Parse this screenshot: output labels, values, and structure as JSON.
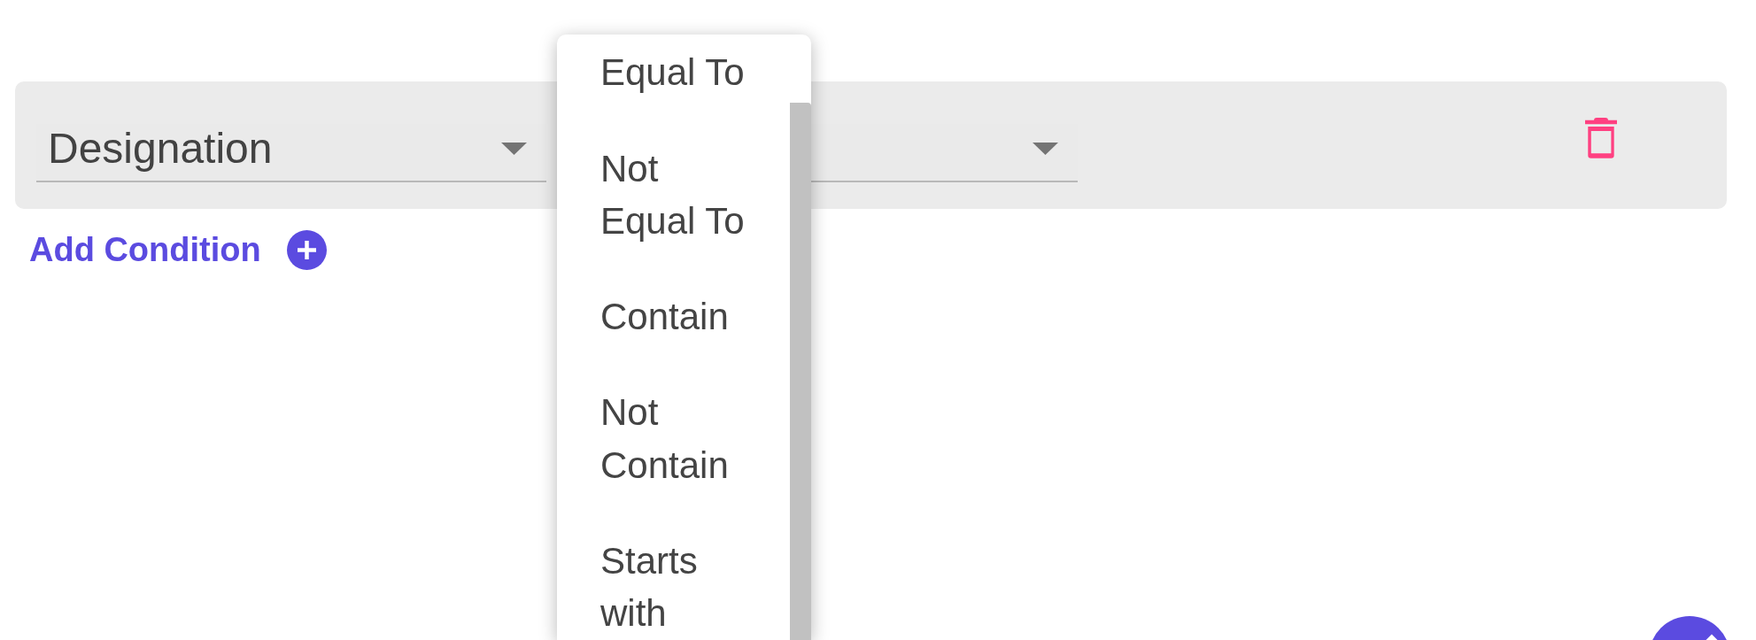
{
  "condition_row": {
    "fields": [
      {
        "value": "Designation"
      },
      {
        "open": true,
        "options": [
          {
            "label": "Equal To",
            "selected": false
          },
          {
            "label": "Not Equal To",
            "selected": false
          },
          {
            "label": "Contain",
            "selected": false
          },
          {
            "label": "Not Contain",
            "selected": false
          },
          {
            "label": "Starts with",
            "selected": false
          }
        ]
      }
    ]
  },
  "add_condition": {
    "label": "Add Condition"
  }
}
